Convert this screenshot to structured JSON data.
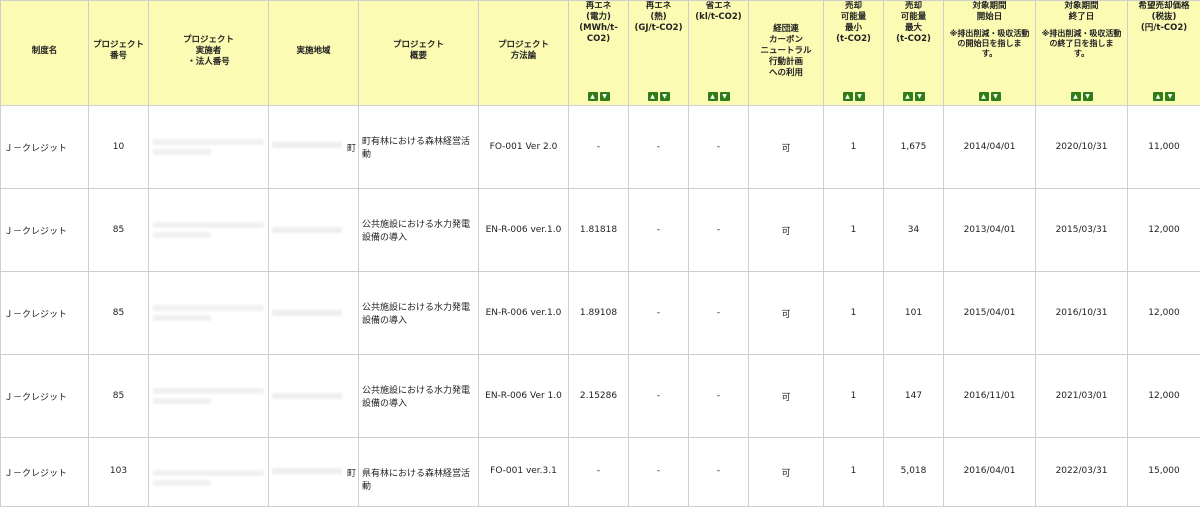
{
  "headers": [
    {
      "id": "system",
      "label": "制度名",
      "sortable": false,
      "top": false
    },
    {
      "id": "project_no",
      "label": "プロジェクト\n番号",
      "sortable": false,
      "top": false
    },
    {
      "id": "implementer",
      "label": "プロジェクト\n実施者\n・法人番号",
      "sortable": false,
      "top": false
    },
    {
      "id": "area",
      "label": "実施地域",
      "sortable": false,
      "top": false
    },
    {
      "id": "summary",
      "label": "プロジェクト\n概要",
      "sortable": false,
      "top": false
    },
    {
      "id": "method",
      "label": "プロジェクト\n方法論",
      "sortable": false,
      "top": false
    },
    {
      "id": "re_power",
      "label": "再エネ\n(電力)\n(MWh/t-CO2)",
      "sortable": true,
      "top": true
    },
    {
      "id": "re_heat",
      "label": "再エネ\n(熱)\n(GJ/t-CO2)",
      "sortable": true,
      "top": true
    },
    {
      "id": "energy_saving",
      "label": "省エネ\n(kl/t-CO2)",
      "sortable": true,
      "top": true
    },
    {
      "id": "keidanren",
      "label": "経団連\nカーボン\nニュートラル\n行動計画\nへの利用",
      "sortable": false,
      "top": false
    },
    {
      "id": "sell_min",
      "label": "売却\n可能量\n最小\n(t-CO2)",
      "sortable": true,
      "top": true
    },
    {
      "id": "sell_max",
      "label": "売却\n可能量\n最大\n(t-CO2)",
      "sortable": true,
      "top": true
    },
    {
      "id": "period_start",
      "label": "対象期間\n開始日",
      "note": "※排出削減・吸収活動\nの開始日を指しま\nす。",
      "sortable": true,
      "top": true
    },
    {
      "id": "period_end",
      "label": "対象期間\n終了日",
      "note": "※排出削減・吸収活動\nの終了日を指しま\nす。",
      "sortable": true,
      "top": true
    },
    {
      "id": "price",
      "label": "希望売却価格\n(税抜)\n(円/t-CO2)",
      "sortable": true,
      "top": true
    }
  ],
  "sort_icons": {
    "asc": "▲",
    "desc": "▼",
    "color": "#2e7d1a"
  },
  "rows": [
    {
      "system": "Ｊ－クレジット",
      "project_no": "10",
      "area_suffix": "町",
      "summary": "町有林における森林経営活動",
      "method": "FO-001 Ver 2.0",
      "re_power": "-",
      "re_heat": "-",
      "energy_saving": "-",
      "keidanren": "可",
      "sell_min": "1",
      "sell_max": "1,675",
      "period_start": "2014/04/01",
      "period_end": "2020/10/31",
      "price": "11,000"
    },
    {
      "system": "Ｊ－クレジット",
      "project_no": "85",
      "area_suffix": "",
      "summary": "公共施設における水力発電設備の導入",
      "method": "EN-R-006 ver.1.0",
      "re_power": "1.81818",
      "re_heat": "-",
      "energy_saving": "-",
      "keidanren": "可",
      "sell_min": "1",
      "sell_max": "34",
      "period_start": "2013/04/01",
      "period_end": "2015/03/31",
      "price": "12,000"
    },
    {
      "system": "Ｊ－クレジット",
      "project_no": "85",
      "area_suffix": "",
      "summary": "公共施設における水力発電設備の導入",
      "method": "EN-R-006 ver.1.0",
      "re_power": "1.89108",
      "re_heat": "-",
      "energy_saving": "-",
      "keidanren": "可",
      "sell_min": "1",
      "sell_max": "101",
      "period_start": "2015/04/01",
      "period_end": "2016/10/31",
      "price": "12,000"
    },
    {
      "system": "Ｊ－クレジット",
      "project_no": "85",
      "area_suffix": "",
      "summary": "公共施設における水力発電設備の導入",
      "method": "EN-R-006 Ver 1.0",
      "re_power": "2.15286",
      "re_heat": "-",
      "energy_saving": "-",
      "keidanren": "可",
      "sell_min": "1",
      "sell_max": "147",
      "period_start": "2016/11/01",
      "period_end": "2021/03/01",
      "price": "12,000"
    },
    {
      "system": "Ｊ－クレジット",
      "project_no": "103",
      "area_suffix": "町",
      "summary": "県有林における森林経営活動",
      "method": "FO-001 ver.3.1",
      "re_power": "-",
      "re_heat": "-",
      "energy_saving": "-",
      "keidanren": "可",
      "sell_min": "1",
      "sell_max": "5,018",
      "period_start": "2016/04/01",
      "period_end": "2022/03/31",
      "price": "15,000"
    }
  ]
}
